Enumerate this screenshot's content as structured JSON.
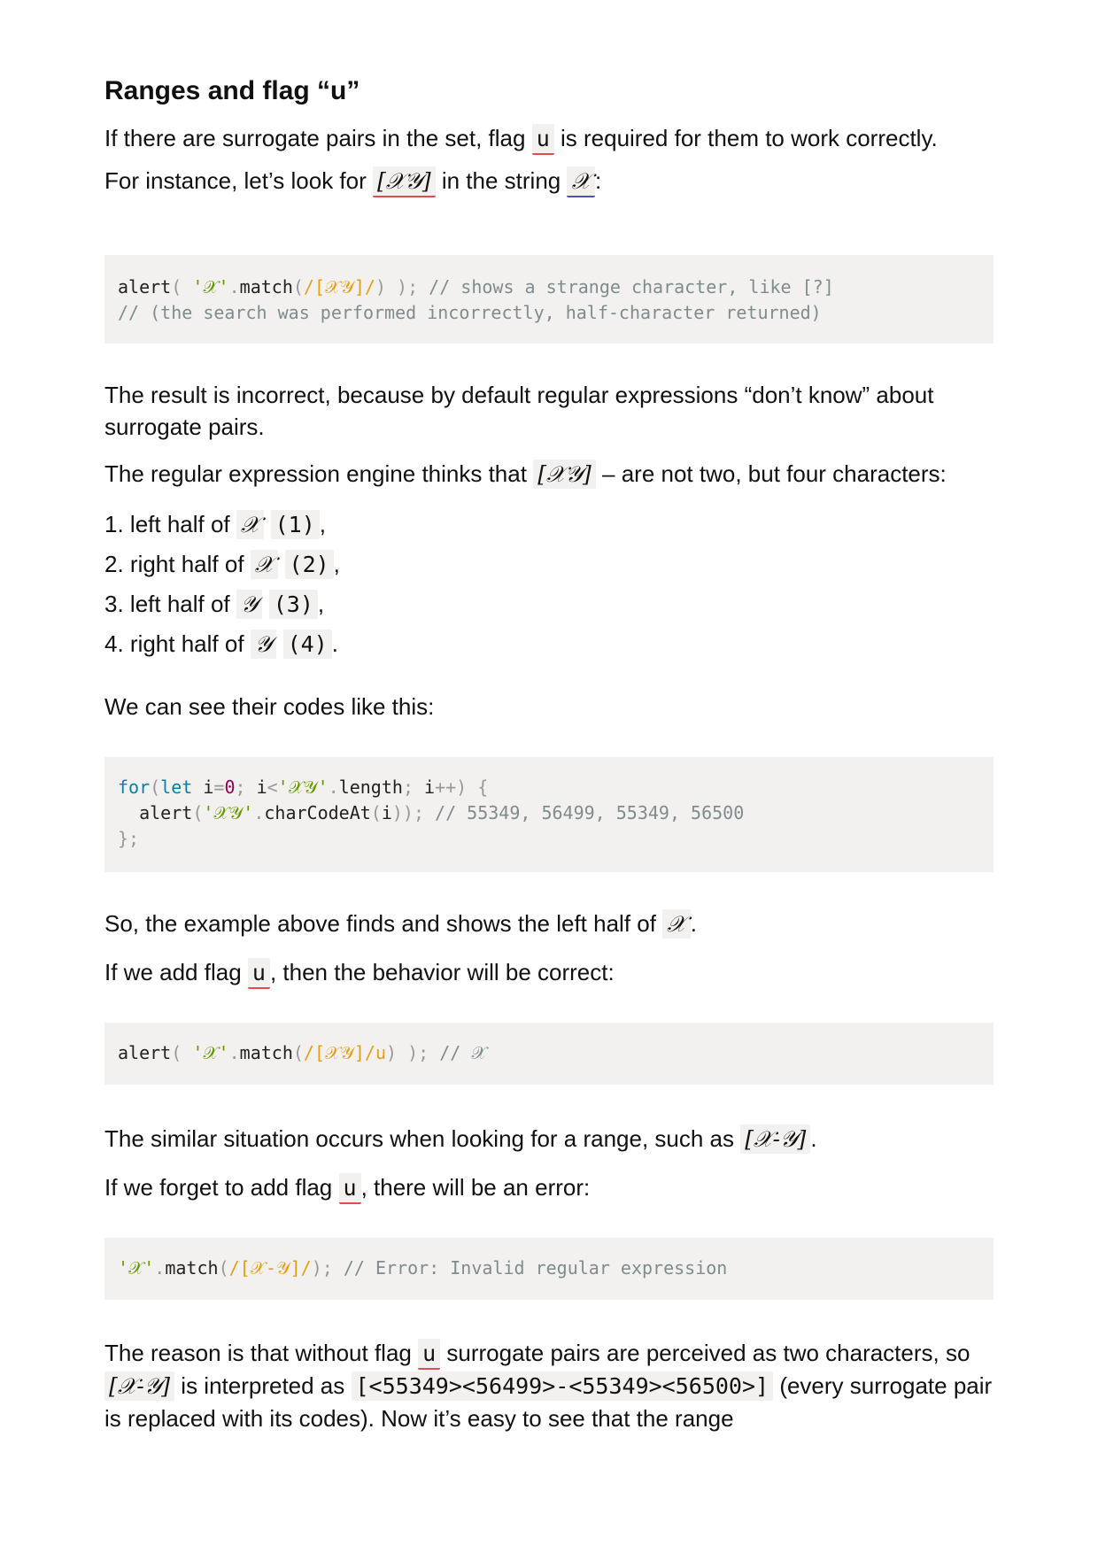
{
  "heading": "Ranges and flag “u”",
  "p1": {
    "before": "If there are surrogate pairs in the set, flag ",
    "code": "u",
    "after": " is required for them to work correctly."
  },
  "p2": {
    "before": "For instance, let’s look for ",
    "code": "[𝒳𝒴]",
    "middle": " in the string ",
    "code2": "𝒳",
    "after": ":"
  },
  "code1": {
    "line1": {
      "fn": "alert",
      "p_open": "( ",
      "str": "'𝒳'",
      "dot": ".",
      "method": "match",
      "paren": "(",
      "regex": "/[𝒳𝒴]/",
      "close": ") );",
      "comment": " // shows a strange character, like [?]"
    },
    "line2": {
      "comment": "// (the search was performed incorrectly, half-character returned)"
    }
  },
  "p3": "The result is incorrect, because by default regular expressions “don’t know” about surrogate pairs.",
  "p4": {
    "before": "The regular expression engine thinks that ",
    "code": "[𝒳𝒴]",
    "after": " – are not two, but four characters:"
  },
  "list": [
    {
      "num": "1.",
      "text": " left half of ",
      "char": "𝒳",
      "code": "(1)",
      "end": ","
    },
    {
      "num": "2.",
      "text": " right half of ",
      "char": "𝒳",
      "code": "(2)",
      "end": ","
    },
    {
      "num": "3.",
      "text": " left half of ",
      "char": "𝒴",
      "code": "(3)",
      "end": ","
    },
    {
      "num": "4.",
      "text": " right half of ",
      "char": "𝒴",
      "code": "(4)",
      "end": "."
    }
  ],
  "p5": "We can see their codes like this:",
  "code2": {
    "line1": {
      "kw_for": "for",
      "paren": "(",
      "kw_let": "let",
      "var": " i",
      "eq": "=",
      "zero": "0",
      "semi": "; ",
      "var2": "i",
      "lt": "<",
      "str": "'𝒳𝒴'",
      "dot": ".",
      "prop": "length",
      "semi2": "; ",
      "var3": "i",
      "inc": "++",
      "close": ") {"
    },
    "line2": {
      "indent": "  ",
      "fn": "alert",
      "paren": "(",
      "str": "'𝒳𝒴'",
      "dot": ".",
      "method": "charCodeAt",
      "arg_open": "(",
      "arg": "i",
      "arg_close": "));",
      "comment": " // 55349, 56499, 55349, 56500"
    },
    "line3": {
      "close": "};"
    }
  },
  "p6": {
    "before": "So, the example above finds and shows the left half of ",
    "code": "𝒳",
    "after": "."
  },
  "p7": {
    "before": "If we add flag ",
    "code": "u",
    "after": ", then the behavior will be correct:"
  },
  "code3": {
    "fn": "alert",
    "p_open": "( ",
    "str": "'𝒳'",
    "dot": ".",
    "method": "match",
    "paren": "(",
    "regex": "/[𝒳𝒴]/u",
    "close": ") );",
    "comment": " // 𝒳"
  },
  "p8": {
    "before": "The similar situation occurs when looking for a range, such as ",
    "code": "[𝒳-𝒴]",
    "after": "."
  },
  "p9": {
    "before": "If we forget to add flag ",
    "code": "u",
    "after": ", there will be an error:"
  },
  "code4": {
    "str": "'𝒳'",
    "dot": ".",
    "method": "match",
    "paren": "(",
    "regex": "/[𝒳-𝒴]/",
    "close": ");",
    "comment": " // Error: Invalid regular expression"
  },
  "p10": {
    "a": "The reason is that without flag ",
    "code1": "u",
    "b": " surrogate pairs are perceived as two characters, so ",
    "code2": "[𝒳-𝒴]",
    "c": " is interpreted as ",
    "code3": "[<55349><56499>-<55349><56500>]",
    "d": " (every surrogate pair is replaced with its codes). Now it’s easy to see that the range"
  }
}
